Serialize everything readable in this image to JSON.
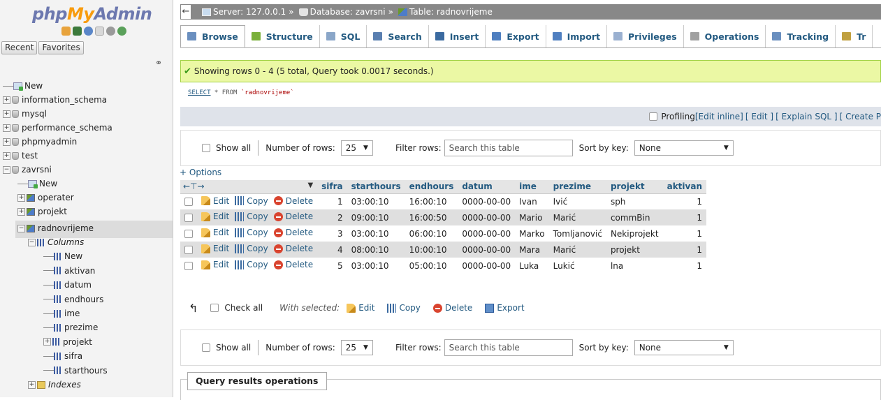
{
  "nav": {
    "logo_php": "php",
    "logo_my": "My",
    "logo_admin": "Admin",
    "recent_label": "Recent",
    "favorites_label": "Favorites",
    "tree": [
      {
        "label": "New",
        "level": 0,
        "icon": "new-icon"
      },
      {
        "label": "information_schema",
        "level": 0,
        "icon": "database-icon"
      },
      {
        "label": "mysql",
        "level": 0,
        "icon": "database-icon"
      },
      {
        "label": "performance_schema",
        "level": 0,
        "icon": "database-icon"
      },
      {
        "label": "phpmyadmin",
        "level": 0,
        "icon": "database-icon"
      },
      {
        "label": "test",
        "level": 0,
        "icon": "database-icon"
      },
      {
        "label": "zavrsni",
        "level": 0,
        "icon": "database-icon"
      },
      {
        "label": "New",
        "level": 1,
        "icon": "new-icon"
      },
      {
        "label": "operater",
        "level": 1,
        "icon": "table-icon"
      },
      {
        "label": "projekt",
        "level": 1,
        "icon": "table-icon"
      },
      {
        "label": "radnovrijeme",
        "level": 1,
        "icon": "table-icon"
      },
      {
        "label": "Columns",
        "level": 2,
        "icon": "columns-icon"
      },
      {
        "label": "New",
        "level": 3,
        "icon": "new-column-icon"
      },
      {
        "label": "aktivan",
        "level": 3,
        "icon": "column-icon"
      },
      {
        "label": "datum",
        "level": 3,
        "icon": "column-icon"
      },
      {
        "label": "endhours",
        "level": 3,
        "icon": "column-icon"
      },
      {
        "label": "ime",
        "level": 3,
        "icon": "column-icon"
      },
      {
        "label": "prezime",
        "level": 3,
        "icon": "column-icon"
      },
      {
        "label": "projekt",
        "level": 3,
        "icon": "column-icon"
      },
      {
        "label": "sifra",
        "level": 3,
        "icon": "column-icon"
      },
      {
        "label": "starthours",
        "level": 3,
        "icon": "column-icon"
      },
      {
        "label": "Indexes",
        "level": 2,
        "icon": "indexes-icon"
      }
    ]
  },
  "breadcrumb": {
    "server": "Server: 127.0.0.1",
    "database": "Database: zavrsni",
    "table": "Table: radnovrijeme",
    "sep": "»"
  },
  "tabs": [
    {
      "label": "Browse",
      "icon": "browse-icon",
      "color": "#6a8fbf"
    },
    {
      "label": "Structure",
      "icon": "structure-icon",
      "color": "#7ab03a"
    },
    {
      "label": "SQL",
      "icon": "sql-icon",
      "color": "#8aa6c8"
    },
    {
      "label": "Search",
      "icon": "search-icon",
      "color": "#5a7fb0"
    },
    {
      "label": "Insert",
      "icon": "insert-icon",
      "color": "#3b6aa0"
    },
    {
      "label": "Export",
      "icon": "export-icon",
      "color": "#4f7fc0"
    },
    {
      "label": "Import",
      "icon": "import-icon",
      "color": "#4f7fc0"
    },
    {
      "label": "Privileges",
      "icon": "privileges-icon",
      "color": "#9ab0d0"
    },
    {
      "label": "Operations",
      "icon": "operations-icon",
      "color": "#a0a0a0"
    },
    {
      "label": "Tracking",
      "icon": "tracking-icon",
      "color": "#6a8fbf"
    },
    {
      "label": "Tr",
      "icon": "triggers-icon",
      "color": "#c0a040"
    }
  ],
  "success_message": "Showing rows 0 - 4 (5 total, Query took 0.0017 seconds.)",
  "sql": {
    "select": "SELECT",
    "rest": " * FROM ",
    "table": "`radnovrijeme`"
  },
  "profiling": {
    "label": "Profiling",
    "links": [
      "[Edit inline]",
      "[ Edit ]",
      "[ Explain SQL ]",
      "[ Create P"
    ]
  },
  "navigation": {
    "show_all": "Show all",
    "number_of_rows_label": "Number of rows:",
    "number_of_rows_value": "25",
    "filter_label": "Filter rows:",
    "filter_placeholder": "Search this table",
    "sort_label": "Sort by key:",
    "sort_value": "None"
  },
  "options_label": "+ Options",
  "table": {
    "columns": [
      "sifra",
      "starthours",
      "endhours",
      "datum",
      "ime",
      "prezime",
      "projekt",
      "aktivan"
    ],
    "action_labels": {
      "edit": "Edit",
      "copy": "Copy",
      "delete": "Delete"
    },
    "rows": [
      [
        "1",
        "03:00:10",
        "16:00:10",
        "0000-00-00",
        "Ivan",
        "Ivić",
        "sph",
        "1"
      ],
      [
        "2",
        "09:00:10",
        "16:00:50",
        "0000-00-00",
        "Mario",
        "Marić",
        "commBin",
        "1"
      ],
      [
        "3",
        "03:00:10",
        "06:00:10",
        "0000-00-00",
        "Marko",
        "Tomljanović",
        "Nekiprojekt",
        "1"
      ],
      [
        "4",
        "08:00:10",
        "10:00:10",
        "0000-00-00",
        "Mara",
        "Marić",
        "projekt",
        "1"
      ],
      [
        "5",
        "03:00:10",
        "05:00:10",
        "0000-00-00",
        "Luka",
        "Lukić",
        "lna",
        "1"
      ]
    ]
  },
  "bulk": {
    "check_all": "Check all",
    "with_selected": "With selected:",
    "edit": "Edit",
    "copy": "Copy",
    "delete": "Delete",
    "export": "Export"
  },
  "query_results_title": "Query results operations"
}
